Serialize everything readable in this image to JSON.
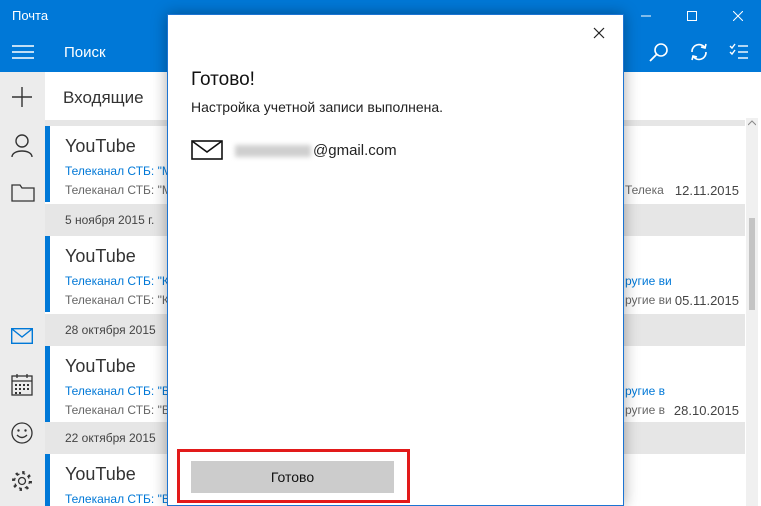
{
  "window": {
    "title": "Почта"
  },
  "toolbar": {
    "search_label": "Поиск"
  },
  "folder": {
    "title": "Входящие"
  },
  "messages": [
    {
      "sender": "YouTube",
      "subject": "Телеканал СТБ: \"М",
      "preview": "Телеканал СТБ: \"М",
      "subject_right": "",
      "preview_right": "Телека",
      "date": "12.11.2015"
    },
    {
      "sender": "YouTube",
      "subject": "Телеканал СТБ: \"К",
      "preview": "Телеканал СТБ: \"К",
      "subject_right": "ругие ви",
      "preview_right": "ругие ви",
      "date": "05.11.2015"
    },
    {
      "sender": "YouTube",
      "subject": "Телеканал СТБ: \"В",
      "preview": "Телеканал СТБ: \"В",
      "subject_right": "ругие в",
      "preview_right": "ругие в",
      "date": "28.10.2015"
    },
    {
      "sender": "YouTube",
      "subject": "Телеканал СТБ: \"В",
      "preview": "",
      "subject_right": "",
      "preview_right": "",
      "date": ""
    }
  ],
  "separators": [
    "5 ноября 2015 г.",
    "28 октября 2015",
    "22 октября 2015"
  ],
  "dialog": {
    "title": "Готово!",
    "subtitle": "Настройка учетной записи выполнена.",
    "email_domain": "@gmail.com",
    "done_button": "Готово"
  },
  "icons": {
    "menu": "hamburger-icon",
    "search": "search-icon",
    "sync": "sync-icon",
    "select": "select-mode-icon",
    "compose": "plus-icon",
    "accounts": "person-icon",
    "folders": "folder-icon",
    "mail": "mail-icon",
    "calendar": "calendar-icon",
    "feedback": "smiley-icon",
    "settings": "gear-icon"
  },
  "colors": {
    "accent": "#0078d7",
    "highlight": "#e21a1a"
  }
}
